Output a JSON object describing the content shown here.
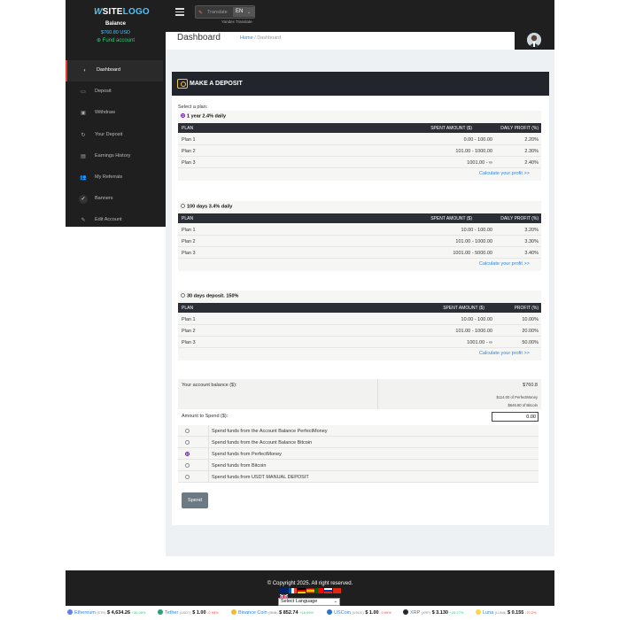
{
  "sidebar": {
    "logo": {
      "mark": "W",
      "site": "SITE",
      "logo": "LOGO"
    },
    "balance_label": "Balance",
    "balance_value": "$760.80 USD",
    "fund_account": "Fund account",
    "items": [
      {
        "label": "Dashboard",
        "icon": "speedometer-icon",
        "glyph": "◐",
        "active": true
      },
      {
        "label": "Deposit",
        "icon": "wallet-icon",
        "glyph": "▭"
      },
      {
        "label": "Withdraw",
        "icon": "money-icon",
        "glyph": "▣"
      },
      {
        "label": "Your Deposit",
        "icon": "refresh-icon",
        "glyph": "↻"
      },
      {
        "label": "Earnings History",
        "icon": "history-icon",
        "glyph": "▤"
      },
      {
        "label": "My Referrals",
        "icon": "users-icon",
        "glyph": "👥"
      },
      {
        "label": "Banners",
        "icon": "check-icon",
        "glyph": "✓"
      },
      {
        "label": "Edit Account",
        "icon": "pencil-icon",
        "glyph": "✎"
      }
    ]
  },
  "topbar": {
    "translate_label": "Translate",
    "language": "EN",
    "yandex": "Yandex Translate"
  },
  "header": {
    "title": "Dashboard",
    "breadcrumb_home": "Home",
    "breadcrumb_sep": "/",
    "breadcrumb_current": "Dashboard"
  },
  "deposit": {
    "title": "MAKE A DEPOSIT",
    "select_plan": "Select a plan:",
    "plans": [
      {
        "name": "1 year 2.4% daily",
        "selected": true,
        "headers": [
          "PLAN",
          "SPENT AMOUNT ($)",
          "DAILY PROFIT (%)"
        ],
        "rows": [
          [
            "Plan 1",
            "0.00 - 100.00",
            "2.20%"
          ],
          [
            "Plan 2",
            "101.00 - 1000.00",
            "2.30%"
          ],
          [
            "Plan 3",
            "1001.00 - ∞",
            "2.40%"
          ]
        ],
        "calc": "Calculate your profit >>"
      },
      {
        "name": "100 days 3.4% daily",
        "selected": false,
        "headers": [
          "PLAN",
          "SPENT AMOUNT ($)",
          "DAILY PROFIT (%)"
        ],
        "rows": [
          [
            "Plan 1",
            "10.00 - 100.00",
            "3.20%"
          ],
          [
            "Plan 2",
            "101.00 - 1000.00",
            "3.30%"
          ],
          [
            "Plan 3",
            "1001.00 - 5000.00",
            "3.40%"
          ]
        ],
        "calc": "Calculate your profit >>"
      },
      {
        "name": "30 days deposit. 150%",
        "selected": false,
        "headers": [
          "PLAN",
          "SPENT AMOUNT ($)",
          "PROFIT (%)"
        ],
        "rows": [
          [
            "Plan 1",
            "10.00 - 100.00",
            "10.00%"
          ],
          [
            "Plan 2",
            "101.00 - 1000.00",
            "20.00%"
          ],
          [
            "Plan 3",
            "1001.00 - ∞",
            "50.00%"
          ]
        ],
        "calc": "Calculate your profit >>"
      }
    ],
    "account_balance_label": "Your account balance ($):",
    "account_balance_value": "$760.8",
    "pm_balance": "$114.00 of PerfectMoney",
    "btc_balance": "$646.80 of Bitcoin",
    "amount_label": "Amount to Spend ($):",
    "amount_value": "0.00",
    "options": [
      {
        "label": "Spend funds from the Account Balance PerfectMoney",
        "selected": false
      },
      {
        "label": "Spend funds from the Account Balance Bitcoin",
        "selected": false
      },
      {
        "label": "Spend funds from PerfectMoney",
        "selected": true
      },
      {
        "label": "Spend funds from Bitcoin",
        "selected": false
      },
      {
        "label": "Spend funds from USDT MANUAL DEPOSIT",
        "selected": false
      }
    ],
    "spend_button": "Spend"
  },
  "footer": {
    "copyright": "© Copyright 2025. All right reserved.",
    "select_language": "Select Language"
  },
  "ticker": [
    {
      "name": "Ethereum",
      "symbol": "(ETH)",
      "price": "$ 4,634.26",
      "change": "+30.05%",
      "up": true,
      "color": "#627eea"
    },
    {
      "name": "Tether",
      "symbol": "(USDT)",
      "price": "$ 1.00",
      "change": "-0.98%",
      "up": false,
      "color": "#26a17b"
    },
    {
      "name": "Binance Coin",
      "symbol": "(BNB)",
      "price": "$ 852.74",
      "change": "+18.99%",
      "up": true,
      "color": "#f3ba2f"
    },
    {
      "name": "USCoin",
      "symbol": "(USDC)",
      "price": "$ 1.00",
      "change": "-0.99%",
      "up": false,
      "color": "#2775ca"
    },
    {
      "name": "XRP",
      "symbol": "(XRP)",
      "price": "$ 3.130",
      "change": "+29.27%",
      "up": true,
      "color": "#23292f"
    },
    {
      "name": "Luna",
      "symbol": "(LUNA)",
      "price": "$ 0.155",
      "change": "-70.2%",
      "up": false,
      "color": "#ffd83d"
    }
  ],
  "colors": {
    "accent": "#2e86de",
    "sidebar_bg": "#1f1f1f",
    "positive": "#2ecc71",
    "negative": "#e74c3c",
    "active_marker": "#e53935"
  }
}
